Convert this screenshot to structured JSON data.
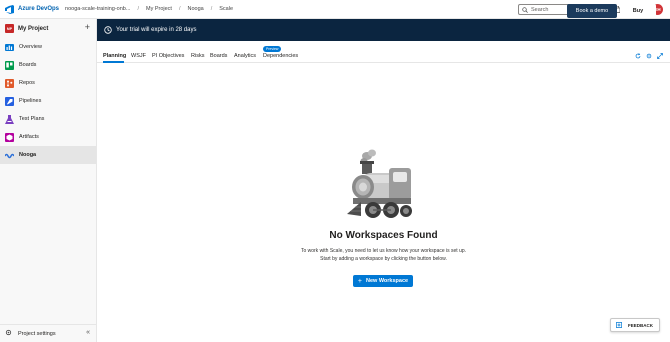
{
  "header": {
    "brand": "Azure DevOps",
    "breadcrumbs": [
      "nooga-scale-training-onb...",
      "My Project",
      "Nooga",
      "Scale"
    ],
    "search_placeholder": "Search",
    "avatar_initials": "EH"
  },
  "sidebar": {
    "project_badge": "MP",
    "project_name": "My Project",
    "items": [
      {
        "label": "Overview",
        "icon": "overview-icon"
      },
      {
        "label": "Boards",
        "icon": "boards-icon"
      },
      {
        "label": "Repos",
        "icon": "repos-icon"
      },
      {
        "label": "Pipelines",
        "icon": "pipelines-icon"
      },
      {
        "label": "Test Plans",
        "icon": "test-plans-icon"
      },
      {
        "label": "Artifacts",
        "icon": "artifacts-icon"
      },
      {
        "label": "Nooga",
        "icon": "nooga-icon",
        "active": true
      }
    ],
    "footer_label": "Project settings"
  },
  "banner": {
    "text": "Your trial will expire in 28 days",
    "demo_label": "Book a demo",
    "buy_label": "Buy"
  },
  "tabs": {
    "items": [
      "Planning",
      "WSJF",
      "PI Objectives",
      "Risks",
      "Boards",
      "Analytics",
      "Dependencies"
    ],
    "active": "Planning",
    "preview_badge": "Preview"
  },
  "empty_state": {
    "title": "No Workspaces Found",
    "description_line1": "To work with Scale, you need to let us know how your workspace is set up.",
    "description_line2": "Start by adding a workspace by clicking the button below.",
    "button_label": "New Workspace"
  },
  "feedback": {
    "label": "FEEDBACK"
  },
  "colors": {
    "accent": "#0078d4",
    "banner_bg": "#0b2540",
    "project_badge": "#c62828",
    "avatar": "#d13438"
  }
}
